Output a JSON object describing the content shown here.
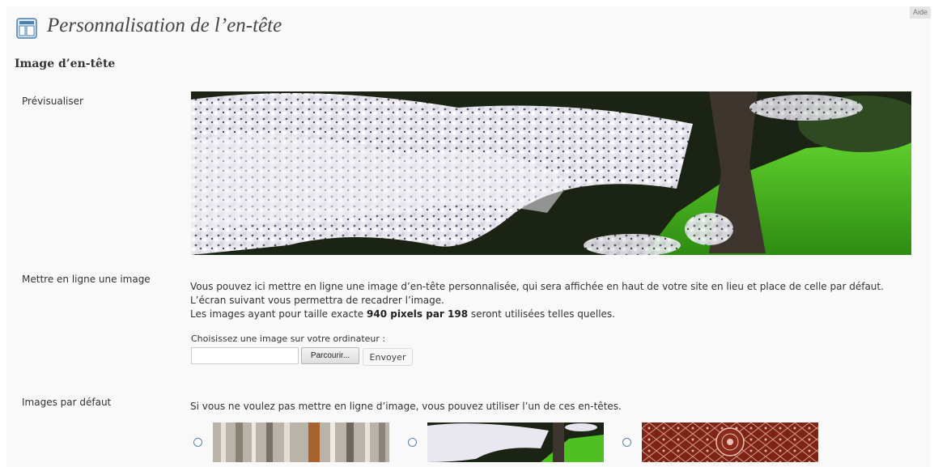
{
  "help_tab": "Aide",
  "page": {
    "title": "Personnalisation de l’en-tête",
    "icon": "appearance-header-icon"
  },
  "section": {
    "title": "Image d’en-tête"
  },
  "preview": {
    "label": "Prévisualiser",
    "image": "cherry-blossom-header-image"
  },
  "upload": {
    "label": "Mettre en ligne une image",
    "description_line1": "Vous pouvez ici mettre en ligne une image d’en-tête personnalisée, qui sera affichée en haut de votre site en lieu et place de celle par défaut. L’écran suivant vous permettra de recadrer l’image.",
    "description_line2_before": "Les images ayant pour taille exacte ",
    "description_line2_bold": "940 pixels par 198",
    "description_line2_after": " seront utilisées telles quelles.",
    "choose_label": "Choisissez une image sur votre ordinateur :",
    "file_value": "",
    "browse_button": "Parcourir...",
    "submit_button": "Envoyer"
  },
  "defaults": {
    "label": "Images par défaut",
    "description": "Si vous ne voulez pas mettre en ligne d’image, vous pouvez utiliser l’un de ces en-têtes.",
    "options": [
      {
        "image": "birch-forest-thumbnail",
        "selected": false
      },
      {
        "image": "cherry-blossom-thumbnail",
        "selected": false
      },
      {
        "image": "red-pattern-thumbnail",
        "selected": false
      }
    ]
  },
  "colors": {
    "page_background": "#f9f9f9",
    "title_color": "#464646",
    "radio_border": "#5b7fb5"
  }
}
